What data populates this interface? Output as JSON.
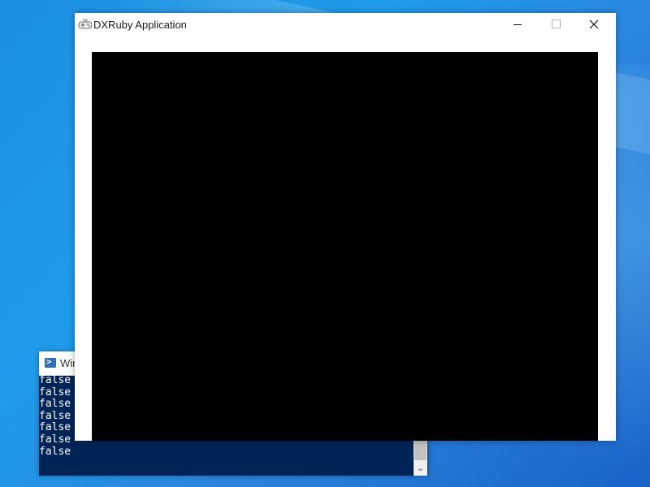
{
  "desktop": {
    "background_color": "#1f8fe2"
  },
  "console": {
    "title": "Wir",
    "icon": "powershell-icon",
    "background_color": "#012456",
    "output_lines": [
      "false",
      "false",
      "false",
      "false",
      "false",
      "false",
      "false"
    ]
  },
  "app_window": {
    "title": "DXRuby Application",
    "icon": "gamepad-icon",
    "minimize_icon": "minimize-icon",
    "maximize_icon": "maximize-icon",
    "close_icon": "close-icon",
    "canvas_color": "#000000"
  }
}
